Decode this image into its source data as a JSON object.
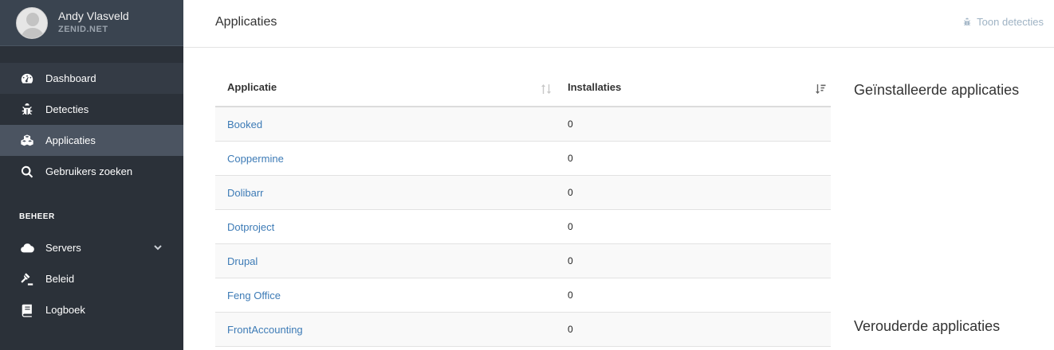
{
  "user": {
    "name": "Andy Vlasveld",
    "domain": "ZENID.NET"
  },
  "nav": [
    {
      "label": "Dashboard",
      "icon": "dashboard-icon"
    },
    {
      "label": "Detecties",
      "icon": "bug-icon"
    },
    {
      "label": "Applicaties",
      "icon": "cubes-icon",
      "active": true
    },
    {
      "label": "Gebruikers zoeken",
      "icon": "search-icon"
    }
  ],
  "beheer": {
    "heading": "BEHEER",
    "items": [
      {
        "label": "Servers",
        "icon": "cloud-icon"
      },
      {
        "label": "Beleid",
        "icon": "gavel-icon"
      },
      {
        "label": "Logboek",
        "icon": "book-icon"
      }
    ]
  },
  "header": {
    "title": "Applicaties",
    "action": "Toon detecties"
  },
  "table": {
    "columns": [
      "Applicatie",
      "Installaties"
    ],
    "rows": [
      {
        "app": "Booked",
        "installs": "0"
      },
      {
        "app": "Coppermine",
        "installs": "0"
      },
      {
        "app": "Dolibarr",
        "installs": "0"
      },
      {
        "app": "Dotproject",
        "installs": "0"
      },
      {
        "app": "Drupal",
        "installs": "0"
      },
      {
        "app": "Feng Office",
        "installs": "0"
      },
      {
        "app": "FrontAccounting",
        "installs": "0"
      }
    ]
  },
  "side": {
    "installed_title": "Geïnstalleerde applicaties",
    "outdated_title": "Verouderde applicaties"
  },
  "colors": {
    "sidebar": "#2b3139",
    "active": "#4b5461",
    "link": "#3d7bb6"
  }
}
